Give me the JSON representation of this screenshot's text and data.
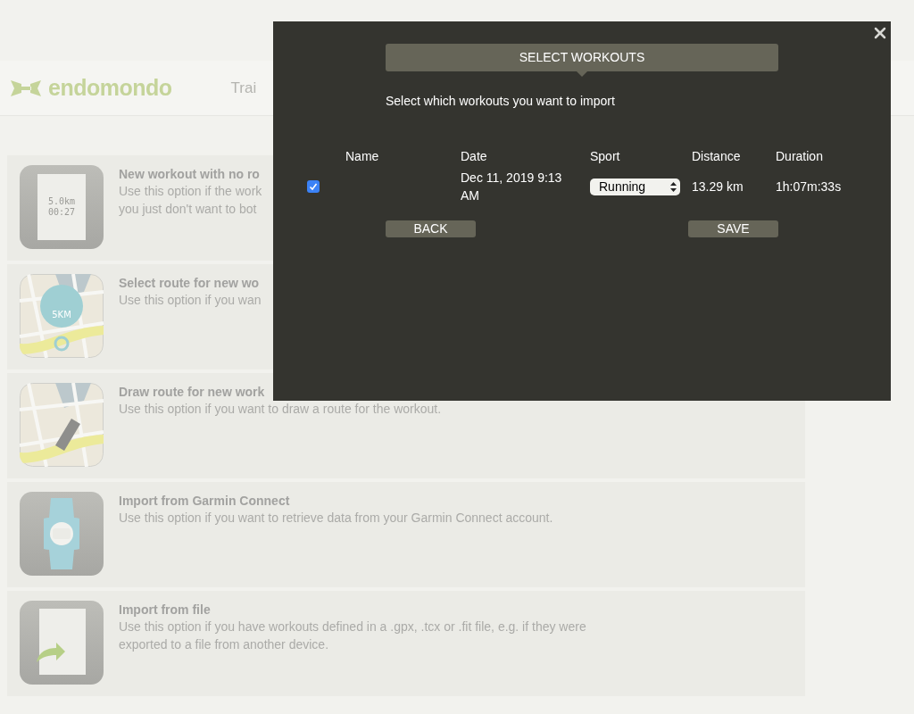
{
  "header": {
    "logo": "endomondo",
    "nav": [
      {
        "label": "Trai"
      }
    ]
  },
  "options": [
    {
      "kind": "note",
      "icon_text": [
        "5.0km",
        "00:27"
      ],
      "title": "New workout with no ro",
      "description": [
        "Use this option if the work",
        "you just don't want to bot"
      ]
    },
    {
      "kind": "route",
      "icon_text": [
        "5KM"
      ],
      "title": "Select route for new wo",
      "description": [
        "Use this option if you wan"
      ]
    },
    {
      "kind": "draw",
      "title": "Draw route for new work",
      "description": [
        "Use this option if you want to draw a route for the workout."
      ]
    },
    {
      "kind": "watch",
      "title": "Import from Garmin Connect",
      "description": [
        "Use this option if you want to retrieve data from your Garmin Connect account."
      ]
    },
    {
      "kind": "file",
      "title": "Import from file",
      "description": [
        "Use this option if you have workouts defined in a .gpx, .tcx or .fit file, e.g. if they were",
        "exported to a file from another device."
      ]
    }
  ],
  "dialog": {
    "title": "SELECT WORKOUTS",
    "subtitle": "Select which workouts you want to import",
    "columns": [
      "Name",
      "Date",
      "Sport",
      "Distance",
      "Duration"
    ],
    "rows": [
      {
        "checked": true,
        "date": "Dec 11, 2019 9:13 AM",
        "sport": "Running",
        "distance": "13.29 km",
        "duration": "1h:07m:33s"
      }
    ],
    "buttons": [
      "BACK",
      "SAVE"
    ]
  }
}
